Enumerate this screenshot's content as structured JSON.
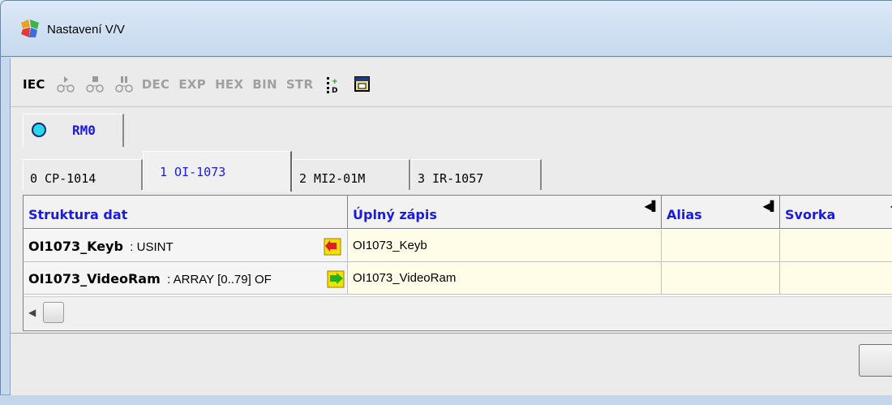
{
  "window": {
    "title": "Nastavení V/V",
    "app_icon": "color-puzzle-icon"
  },
  "toolbar": {
    "iec": "IEC",
    "icons": [
      "run-icon",
      "stop-icon",
      "pause-icon"
    ],
    "formats": [
      "DEC",
      "EXP",
      "HEX",
      "BIN",
      "STR"
    ],
    "extra_icons": [
      "insert-id-icon",
      "window-icon"
    ]
  },
  "rm_tab": {
    "label": "RM0",
    "status_color": "#27d7ea"
  },
  "module_tabs": [
    {
      "label": "0 CP-1014"
    },
    {
      "label": "1 OI-1073"
    },
    {
      "label": "2 MI2-01M"
    },
    {
      "label": "3 IR-1057"
    }
  ],
  "grid": {
    "headers": [
      "Struktura dat",
      "Úplný zápis",
      "Alias",
      "Svorka"
    ],
    "rows": [
      {
        "name": "OI1073_Keyb",
        "type": ": USINT",
        "direction": "input",
        "full": "OI1073_Keyb",
        "alias": "",
        "terminal": ""
      },
      {
        "name": "OI1073_VideoRam",
        "type": ": ARRAY [0..79] OF",
        "direction": "output",
        "full": "OI1073_VideoRam",
        "alias": "",
        "terminal": ""
      }
    ]
  },
  "colors": {
    "accent_text": "#1a1ae0",
    "row_bg": "#fffde8"
  }
}
